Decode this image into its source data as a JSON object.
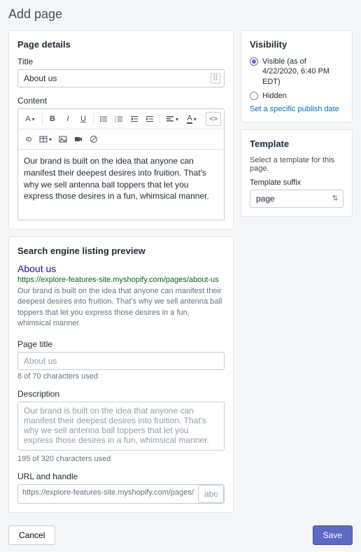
{
  "header": {
    "title": "Add page"
  },
  "details": {
    "card_title": "Page details",
    "title_label": "Title",
    "title_value": "About us",
    "content_label": "Content",
    "content_value": "Our brand is built on the idea that anyone can manifest their deepest desires into fruition. That's why we sell antenna ball toppers that let you express those desires in a fun, whimsical manner."
  },
  "toolbar": {
    "format": "A",
    "bold": "B",
    "italic": "I",
    "underline": "U",
    "html_label": "<>"
  },
  "seo": {
    "card_title": "Search engine listing preview",
    "preview_title": "About us",
    "preview_url": "https://explore-features-site.myshopify.com/pages/about-us",
    "preview_desc": "Our brand is built on the idea that anyone can manifest their deepest desires into fruition. That's why we sell antenna ball toppers that let you express those desires in a fun, whimsical manner.",
    "page_title_label": "Page title",
    "page_title_placeholder": "About us",
    "page_title_helper": "8 of 70 characters used",
    "description_label": "Description",
    "description_placeholder": "Our brand is built on the idea that anyone can manifest their deepest desires into fruition. That's why we sell antenna ball toppers that let you express those desires in a fun, whimsical manner.",
    "description_helper": "195 of 320 characters used",
    "url_label": "URL and handle",
    "url_prefix": "https://explore-features-site.myshopify.com/pages/",
    "url_handle": "about-us"
  },
  "visibility": {
    "card_title": "Visibility",
    "visible_label": "Visible (as of 4/22/2020, 6:40 PM EDT)",
    "hidden_label": "Hidden",
    "link_label": "Set a specific publish date"
  },
  "template": {
    "card_title": "Template",
    "helper": "Select a template for this page.",
    "suffix_label": "Template suffix",
    "value": "page"
  },
  "footer": {
    "cancel": "Cancel",
    "save": "Save"
  }
}
